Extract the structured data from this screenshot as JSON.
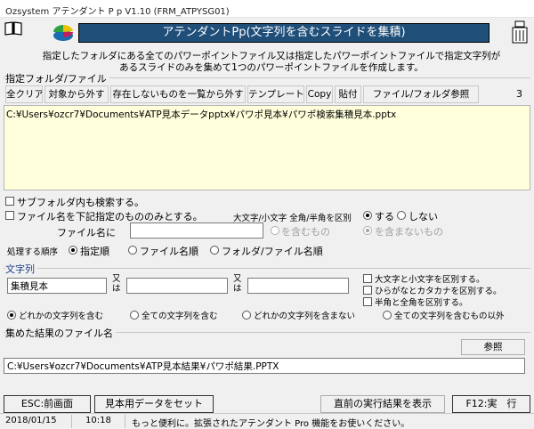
{
  "window": {
    "title": "Ozsystem アテンダント P p V1.10 (FRM_ATPYSG01)"
  },
  "header": {
    "title": "アテンダントPp(文字列を含むスライドを集積)",
    "description_line1": "指定したフォルダにある全てのパワーポイントファイル又は指定したパワーポイントファイルで指定文字列が",
    "description_line2": "あるスライドのみを集めて1つのパワーポイントファイルを作成します。"
  },
  "folder_section": {
    "label": "指定フォルダ/ファイル",
    "buttons": {
      "clear_all": "全クリア",
      "exclude": "対象から外す",
      "remove_missing": "存在しないものを一覧から外す",
      "template": "テンプレート",
      "copy": "Copy",
      "paste": "貼付",
      "browse": "ファイル/フォルダ参照"
    },
    "count": "3",
    "files": [
      "C:¥Users¥ozcr7¥Documents¥ATP見本データpptx¥パワポ見本¥パワポ検索集積見本.pptx"
    ]
  },
  "options": {
    "include_subfolders": "サブフォルダ内も検索する。",
    "filename_filter": "ファイル名を下記指定のもののみとする。",
    "case_width_label": "大文字/小文字 全角/半角を区別",
    "case_yes": "する",
    "case_no": "しない",
    "filename_label": "ファイル名に",
    "filename_value": "",
    "contains": "を含むもの",
    "not_contains": "を含まないもの",
    "order_label": "処理する順序",
    "order_specified": "指定順",
    "order_filename": "ファイル名順",
    "order_folder_filename": "フォルダ/ファイル名順"
  },
  "strings": {
    "label": "文字列",
    "value1": "集積見本",
    "value2": "",
    "value3": "",
    "or_label": "又は",
    "case_sensitive": "大文字と小文字を区別する。",
    "kana_sensitive": "ひらがなとカタカナを区別する。",
    "width_sensitive": "半角と全角を区別する。",
    "mode_any": "どれかの文字列を含む",
    "mode_all": "全ての文字列を含む",
    "mode_not_any": "どれかの文字列を含まない",
    "mode_except_all": "全ての文字列を含むもの以外"
  },
  "result": {
    "label": "集めた結果のファイル名",
    "browse": "参照",
    "path": "C:¥Users¥ozcr7¥Documents¥ATP見本結果¥パワポ結果.PPTX"
  },
  "footer": {
    "esc_button": "ESC:前画面",
    "sample_button": "見本用データをセット",
    "last_result_button": "直前の実行結果を表示",
    "run_button": "F12:実　行"
  },
  "statusbar": {
    "date": "2018/01/15",
    "time": "10:18",
    "message": "もっと便利に。拡張されたアテンダント Pro 機能をお使いください。"
  },
  "colors": {
    "header_bg": "#1f4e79",
    "filelist_bg": "#ffffdc"
  }
}
